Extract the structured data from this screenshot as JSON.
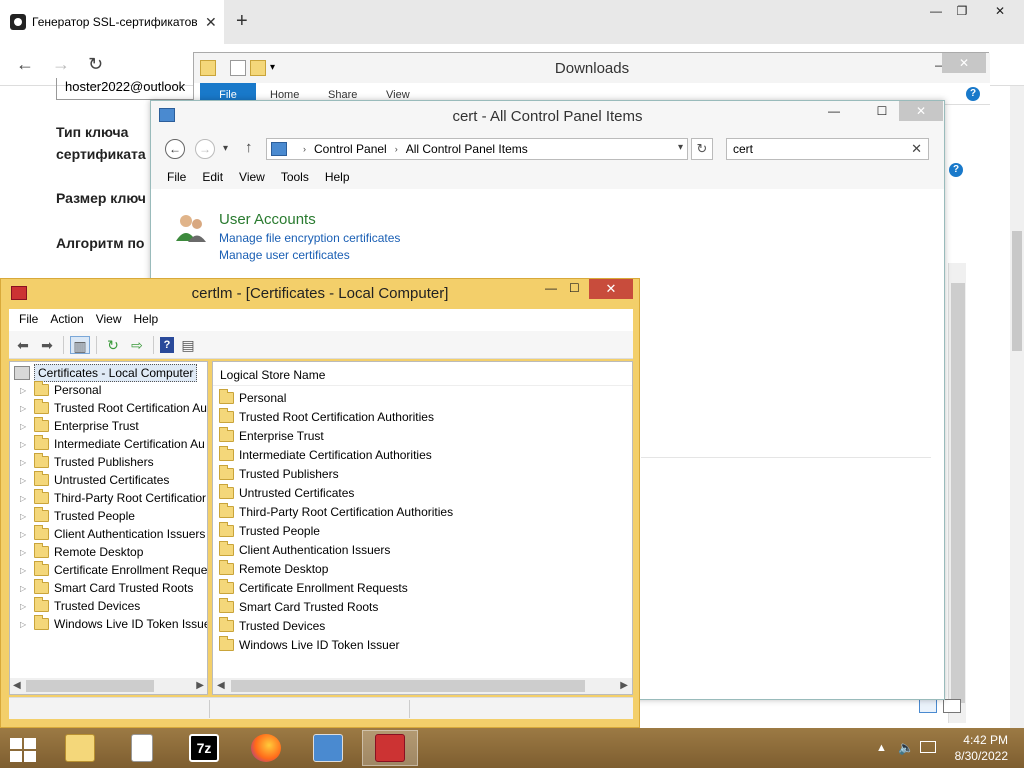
{
  "browser": {
    "tab_title": "Генератор SSL-сертификатов",
    "tab_title_sep": "|",
    "tab_close": "✕",
    "new_tab": "+",
    "window_controls": {
      "minimize": "—",
      "restore": "❐",
      "close": "✕"
    },
    "nav": {
      "back": "←",
      "forward": "→",
      "reload": "↻"
    },
    "email_value": "hoster2022@outlook",
    "labels": {
      "key_type_line1": "Тип ключа",
      "key_type_line2": "сертификата",
      "key_size": "Размер ключ",
      "algorithm": "Алгоритм по"
    }
  },
  "downloads": {
    "title": "Downloads",
    "ribbon_tabs": {
      "file": "File",
      "home": "Home",
      "share": "Share",
      "view": "View"
    },
    "help": "?",
    "qat_dropdown": "▾"
  },
  "control_panel": {
    "title": "cert - All Control Panel Items",
    "nav": {
      "back": "←",
      "forward": "→",
      "history": "▾",
      "up": "↑",
      "refresh": "↻"
    },
    "breadcrumb": [
      "Control Panel",
      "All Control Panel Items"
    ],
    "breadcrumb_sep": "›",
    "search_value": "cert",
    "search_clear": "✕",
    "menu": [
      "File",
      "Edit",
      "View",
      "Tools",
      "Help"
    ],
    "section_title": "User Accounts",
    "links": [
      "Manage file encryption certificates",
      "Manage user certificates"
    ],
    "help": "?"
  },
  "mmc": {
    "title": "certlm - [Certificates - Local Computer]",
    "menu": [
      "File",
      "Action",
      "View",
      "Help"
    ],
    "tree_root": "Certificates - Local Computer",
    "tree_items": [
      "Personal",
      "Trusted Root Certification Au",
      "Enterprise Trust",
      "Intermediate Certification Au",
      "Trusted Publishers",
      "Untrusted Certificates",
      "Third-Party Root Certificatior",
      "Trusted People",
      "Client Authentication Issuers",
      "Remote Desktop",
      "Certificate Enrollment Reques",
      "Smart Card Trusted Roots",
      "Trusted Devices",
      "Windows Live ID Token Issue"
    ],
    "list_header": "Logical Store Name",
    "list_items": [
      "Personal",
      "Trusted Root Certification Authorities",
      "Enterprise Trust",
      "Intermediate Certification Authorities",
      "Trusted Publishers",
      "Untrusted Certificates",
      "Third-Party Root Certification Authorities",
      "Trusted People",
      "Client Authentication Issuers",
      "Remote Desktop",
      "Certificate Enrollment Requests",
      "Smart Card Trusted Roots",
      "Trusted Devices",
      "Windows Live ID Token Issuer"
    ],
    "close": "✕"
  },
  "taskbar": {
    "apps": [
      "file-explorer",
      "notepad",
      "7-zip",
      "firefox",
      "control-panel",
      "certlm"
    ],
    "seven_zip_label": "7z",
    "time": "4:42 PM",
    "date": "8/30/2022"
  },
  "colors": {
    "mmc_frame": "#f3cf6a",
    "mmc_close": "#c84c3c",
    "taskbar": "#8a6a3a",
    "link": "#1a5fb4",
    "section_green": "#2a7b30",
    "ribbon_file": "#1979ca"
  }
}
